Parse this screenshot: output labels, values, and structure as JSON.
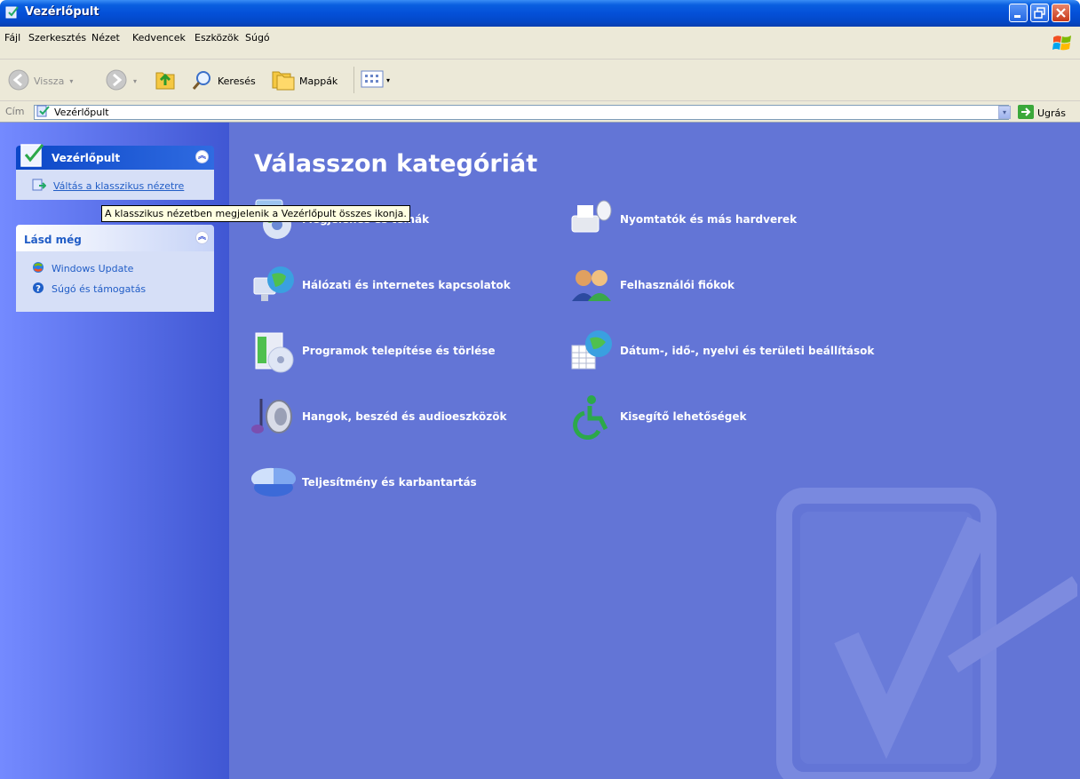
{
  "window": {
    "title": "Vezérlőpult"
  },
  "menu": [
    {
      "label": "Fájl"
    },
    {
      "label": "Szerkesztés"
    },
    {
      "label": "Nézet"
    },
    {
      "label": "Kedvencek"
    },
    {
      "label": "Eszközök"
    },
    {
      "label": "Súgó"
    }
  ],
  "toolbar": {
    "back_label": "Vissza",
    "search_label": "Keresés",
    "folders_label": "Mappák"
  },
  "address": {
    "label": "Cím",
    "value": "Vezérlőpult",
    "go_label": "Ugrás"
  },
  "sidebar": {
    "panel1": {
      "title": "Vezérlőpult",
      "link": "Váltás a klasszikus nézetre"
    },
    "panel2": {
      "title": "Lásd még",
      "links": [
        "Windows Update",
        "Súgó és támogatás"
      ]
    }
  },
  "tooltip": "A klasszikus nézetben megjelenik a Vezérlőpult összes ikonja.",
  "main": {
    "heading": "Válasszon kategóriát",
    "categories": [
      {
        "label": "Megjelenés és témák",
        "icon": "appearance-icon"
      },
      {
        "label": "Nyomtatók és más hardverek",
        "icon": "printer-icon"
      },
      {
        "label": "Hálózati és internetes kapcsolatok",
        "icon": "network-icon"
      },
      {
        "label": "Felhasználói fiókok",
        "icon": "users-icon"
      },
      {
        "label": "Programok telepítése és törlése",
        "icon": "programs-icon"
      },
      {
        "label": "Dátum-, idő-, nyelvi és területi beállítások",
        "icon": "date-globe-icon"
      },
      {
        "label": "Hangok, beszéd és audioeszközök",
        "icon": "sound-icon"
      },
      {
        "label": "Kisegítő lehetőségek",
        "icon": "accessibility-icon"
      },
      {
        "label": "Teljesítmény és karbantartás",
        "icon": "performance-icon"
      }
    ]
  },
  "colors": {
    "title_blue": "#0450d8",
    "sidebar_gradient_start": "#748aff",
    "content_bg": "#6375d6",
    "link": "#215dc6"
  }
}
